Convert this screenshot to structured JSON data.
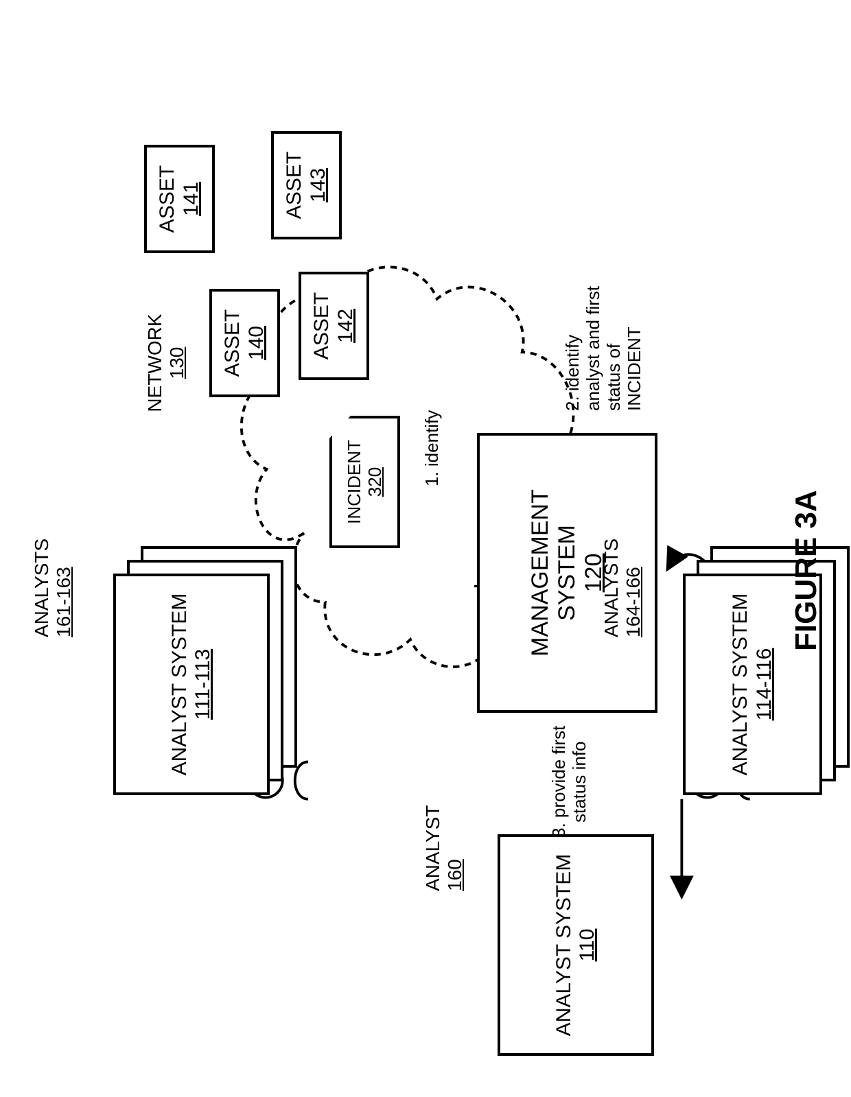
{
  "figure_caption": "FIGURE 3A",
  "network": {
    "label": "NETWORK",
    "ref": "130"
  },
  "assets": {
    "a": {
      "label": "ASSET",
      "ref": "140"
    },
    "b": {
      "label": "ASSET",
      "ref": "141"
    },
    "c": {
      "label": "ASSET",
      "ref": "142"
    },
    "d": {
      "label": "ASSET",
      "ref": "143"
    }
  },
  "incident": {
    "label": "INCIDENT",
    "ref": "320"
  },
  "mgmt": {
    "line1": "MANAGEMENT",
    "line2": "SYSTEM",
    "ref": "120"
  },
  "analyst_single": {
    "label": "ANALYST",
    "ref": "160"
  },
  "analyst_group_top": {
    "label": "ANALYSTS",
    "ref": "161-163"
  },
  "analyst_group_bottom": {
    "label": "ANALYSTS",
    "ref": "164-166"
  },
  "analyst_system_single": {
    "label": "ANALYST SYSTEM",
    "ref": "110"
  },
  "analyst_system_top": {
    "label": "ANALYST SYSTEM",
    "ref": "111-113"
  },
  "analyst_system_bottom": {
    "label": "ANALYST SYSTEM",
    "ref": "114-116"
  },
  "steps": {
    "s1": "1. identify",
    "s2a": "2. identify",
    "s2b": "analyst and first",
    "s2c": "status of",
    "s2d": "INCIDENT",
    "s3a": "3. provide first",
    "s3b": "status info"
  }
}
